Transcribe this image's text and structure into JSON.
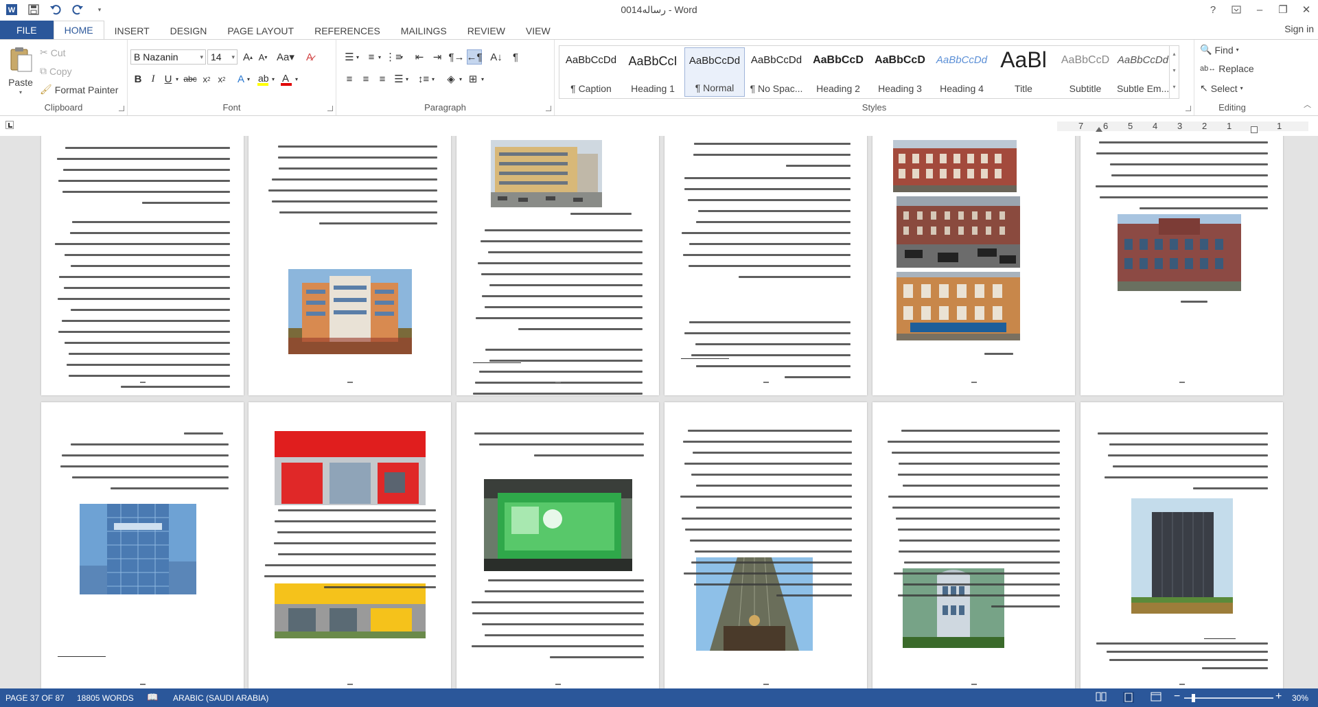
{
  "window": {
    "title": "رساله0014 - Word",
    "help": "?",
    "minimize": "–",
    "restore": "❐",
    "close": "✕"
  },
  "tabs": [
    "FILE",
    "HOME",
    "INSERT",
    "DESIGN",
    "PAGE LAYOUT",
    "REFERENCES",
    "MAILINGS",
    "REVIEW",
    "VIEW"
  ],
  "active_tab": "HOME",
  "signin": "Sign in",
  "clipboard": {
    "paste": "Paste",
    "cut": "Cut",
    "copy": "Copy",
    "format_painter": "Format Painter",
    "label": "Clipboard"
  },
  "font": {
    "name": "B Nazanin",
    "size": "14",
    "label": "Font",
    "highlight_color": "#ffff00",
    "text_color": "#e00000"
  },
  "paragraph": {
    "label": "Paragraph"
  },
  "styles": {
    "label": "Styles",
    "items": [
      {
        "sample": "AaBbCcDd",
        "name": "¶ Caption"
      },
      {
        "sample": "AaBbCcI",
        "name": "Heading 1"
      },
      {
        "sample": "AaBbCcDd",
        "name": "¶ Normal"
      },
      {
        "sample": "AaBbCcDd",
        "name": "¶ No Spac..."
      },
      {
        "sample": "AaBbCcD",
        "name": "Heading 2"
      },
      {
        "sample": "AaBbCcD",
        "name": "Heading 3"
      },
      {
        "sample": "AaBbCcDd",
        "name": "Heading 4"
      },
      {
        "sample": "AaBl",
        "name": "Title"
      },
      {
        "sample": "AaBbCcD",
        "name": "Subtitle"
      },
      {
        "sample": "AaBbCcDd",
        "name": "Subtle Em..."
      }
    ],
    "selected_index": 2
  },
  "editing": {
    "find": "Find",
    "replace": "Replace",
    "select": "Select",
    "label": "Editing"
  },
  "ruler": [
    "7",
    "6",
    "5",
    "4",
    "3",
    "2",
    "1",
    "1"
  ],
  "status": {
    "page": "PAGE 37 OF 87",
    "words": "18805 WORDS",
    "language": "ARABIC (SAUDI ARABIA)",
    "zoom": "30%"
  },
  "colors": {
    "accent": "#2b579a",
    "canvas": "#e3e3e3"
  }
}
